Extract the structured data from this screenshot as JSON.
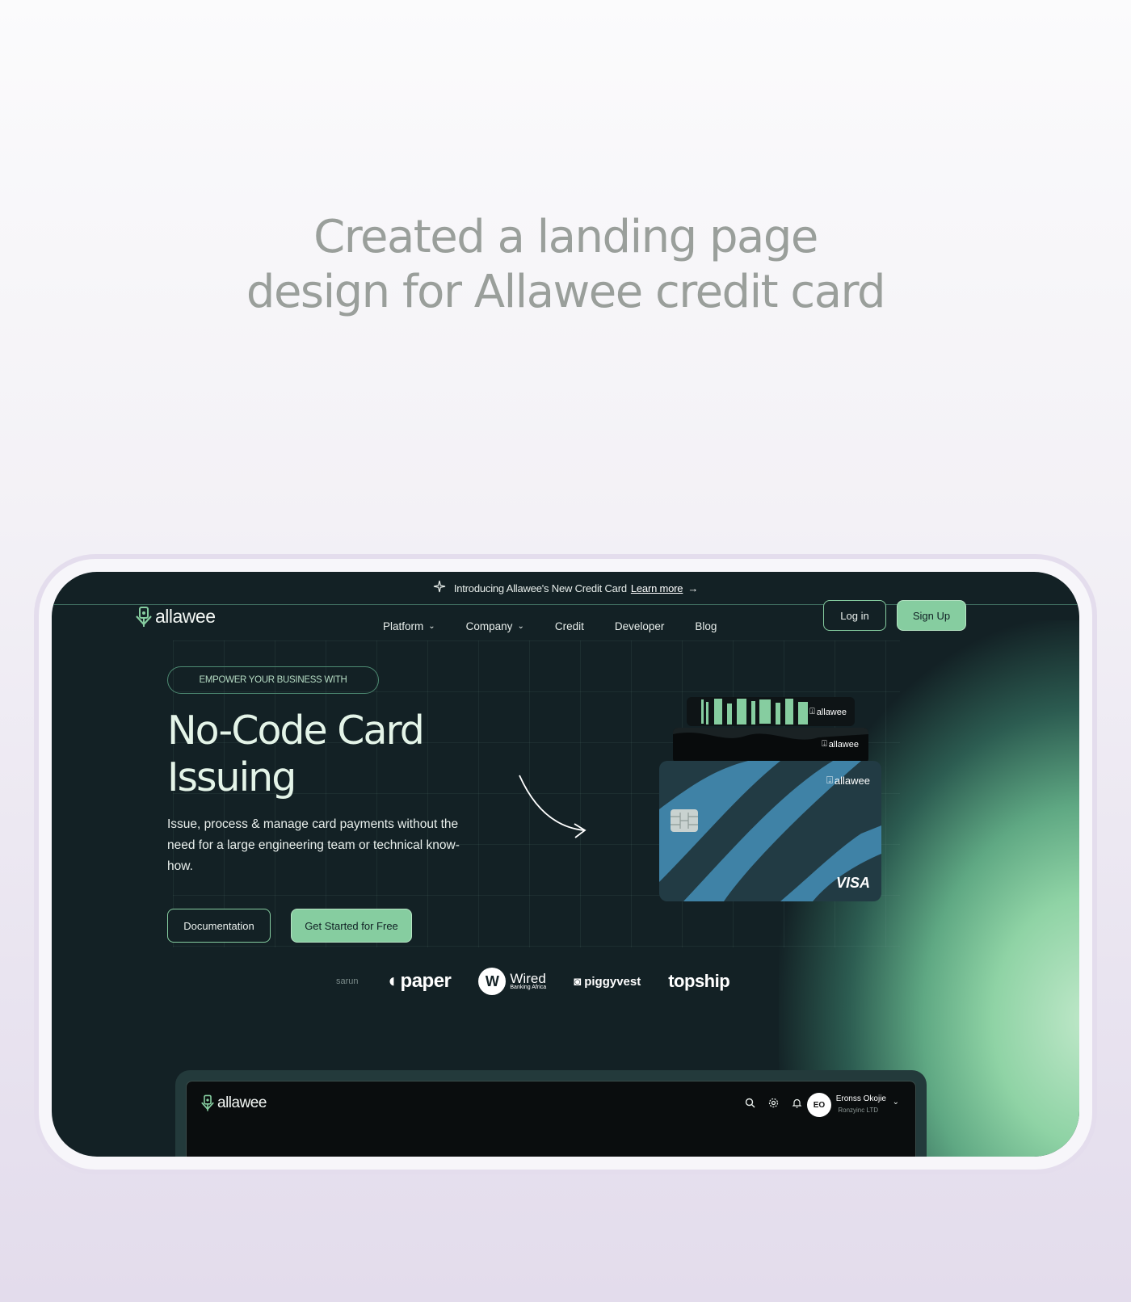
{
  "headline": {
    "line1": "Created a landing page",
    "line2": "design for Allawee credit card"
  },
  "announcement": {
    "text": "Introducing Allawee's New Credit Card",
    "link": "Learn more",
    "arrow": "→"
  },
  "brand": {
    "name": "allawee"
  },
  "nav": {
    "items": [
      {
        "label": "Platform",
        "has_dropdown": true
      },
      {
        "label": "Company",
        "has_dropdown": true
      },
      {
        "label": "Credit",
        "has_dropdown": false
      },
      {
        "label": "Developer",
        "has_dropdown": false
      },
      {
        "label": "Blog",
        "has_dropdown": false
      }
    ],
    "login_label": "Log in",
    "signup_label": "Sign Up"
  },
  "hero": {
    "pill": "EMPOWER YOUR BUSINESS WITH",
    "title_line1": "No-Code Card",
    "title_line2": "Issuing",
    "subtitle": "Issue, process & manage card payments without the need for a large engineering team or technical know-how.",
    "btn_docs": "Documentation",
    "btn_start": "Get Started for Free"
  },
  "cards": {
    "brand": "allawee",
    "network": "VISA"
  },
  "partners": {
    "faded": "sarun",
    "paper": "paper",
    "wired_mark": "W",
    "wired_name": "Wired",
    "wired_tag": "Banking Africa",
    "piggyvest": "piggyvest",
    "topship": "topship"
  },
  "dashboard": {
    "brand": "allawee",
    "avatar_initials": "EO",
    "user_name": "Eronss Okojie",
    "user_company": "Ronzyinc LTD"
  },
  "colors": {
    "accent": "#86cda0",
    "background_dark": "#132125",
    "card_stripe": "#3f82a6"
  }
}
